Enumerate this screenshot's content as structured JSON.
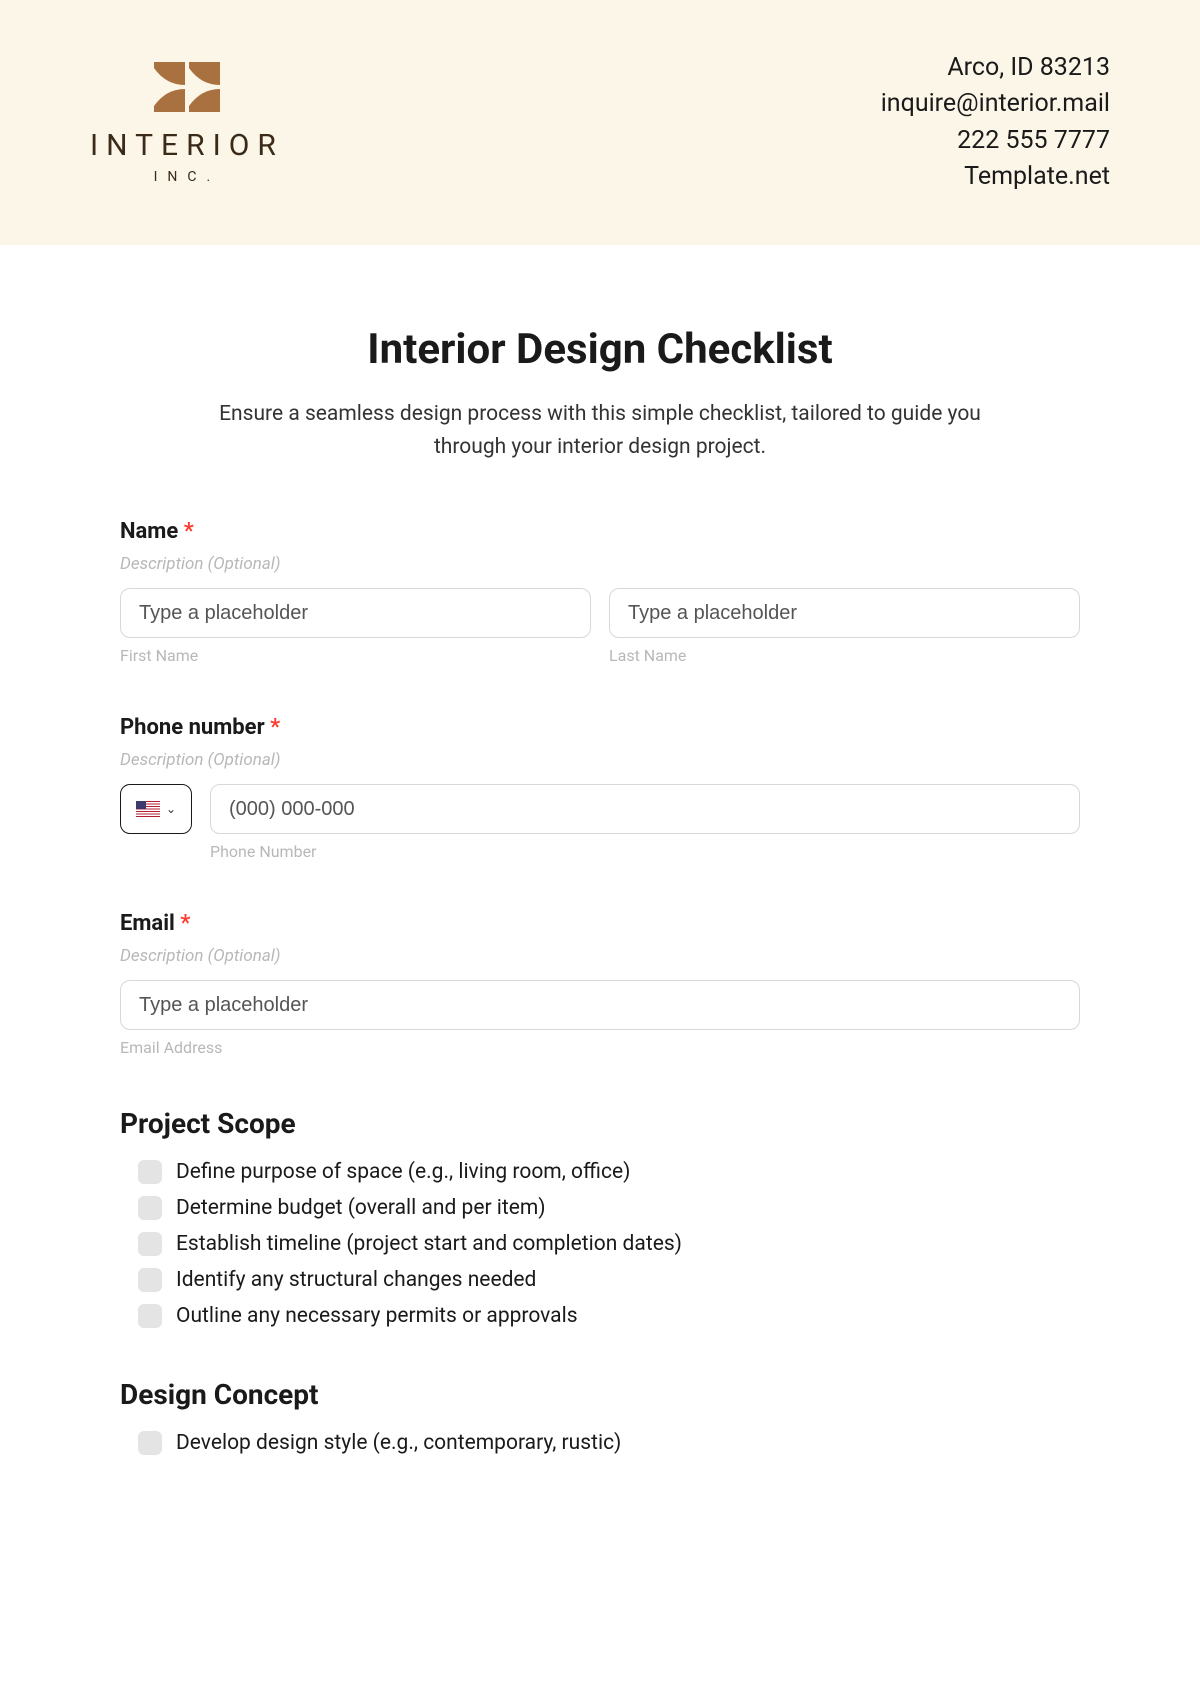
{
  "header": {
    "logo_text": "INTERIOR",
    "logo_sub": "INC.",
    "contact": {
      "address": "Arco, ID 83213",
      "email": "inquire@interior.mail",
      "phone": "222 555 7777",
      "website": "Template.net"
    }
  },
  "title": "Interior Design Checklist",
  "subtitle": "Ensure a seamless design process with this simple checklist, tailored to guide you through your interior design project.",
  "fields": {
    "name": {
      "label": "Name",
      "desc": "Description (Optional)",
      "first_placeholder": "Type a placeholder",
      "last_placeholder": "Type a placeholder",
      "first_sublabel": "First Name",
      "last_sublabel": "Last Name"
    },
    "phone": {
      "label": "Phone number",
      "desc": "Description (Optional)",
      "placeholder": "(000) 000-000",
      "sublabel": "Phone Number"
    },
    "email": {
      "label": "Email",
      "desc": "Description (Optional)",
      "placeholder": "Type a placeholder",
      "sublabel": "Email Address"
    }
  },
  "sections": {
    "scope": {
      "heading": "Project Scope",
      "items": [
        "Define purpose of space (e.g., living room, office)",
        "Determine budget (overall and per item)",
        "Establish timeline (project start and completion dates)",
        "Identify any structural changes needed",
        "Outline any necessary permits or approvals"
      ]
    },
    "concept": {
      "heading": "Design Concept",
      "items": [
        "Develop design style (e.g., contemporary, rustic)"
      ]
    }
  }
}
